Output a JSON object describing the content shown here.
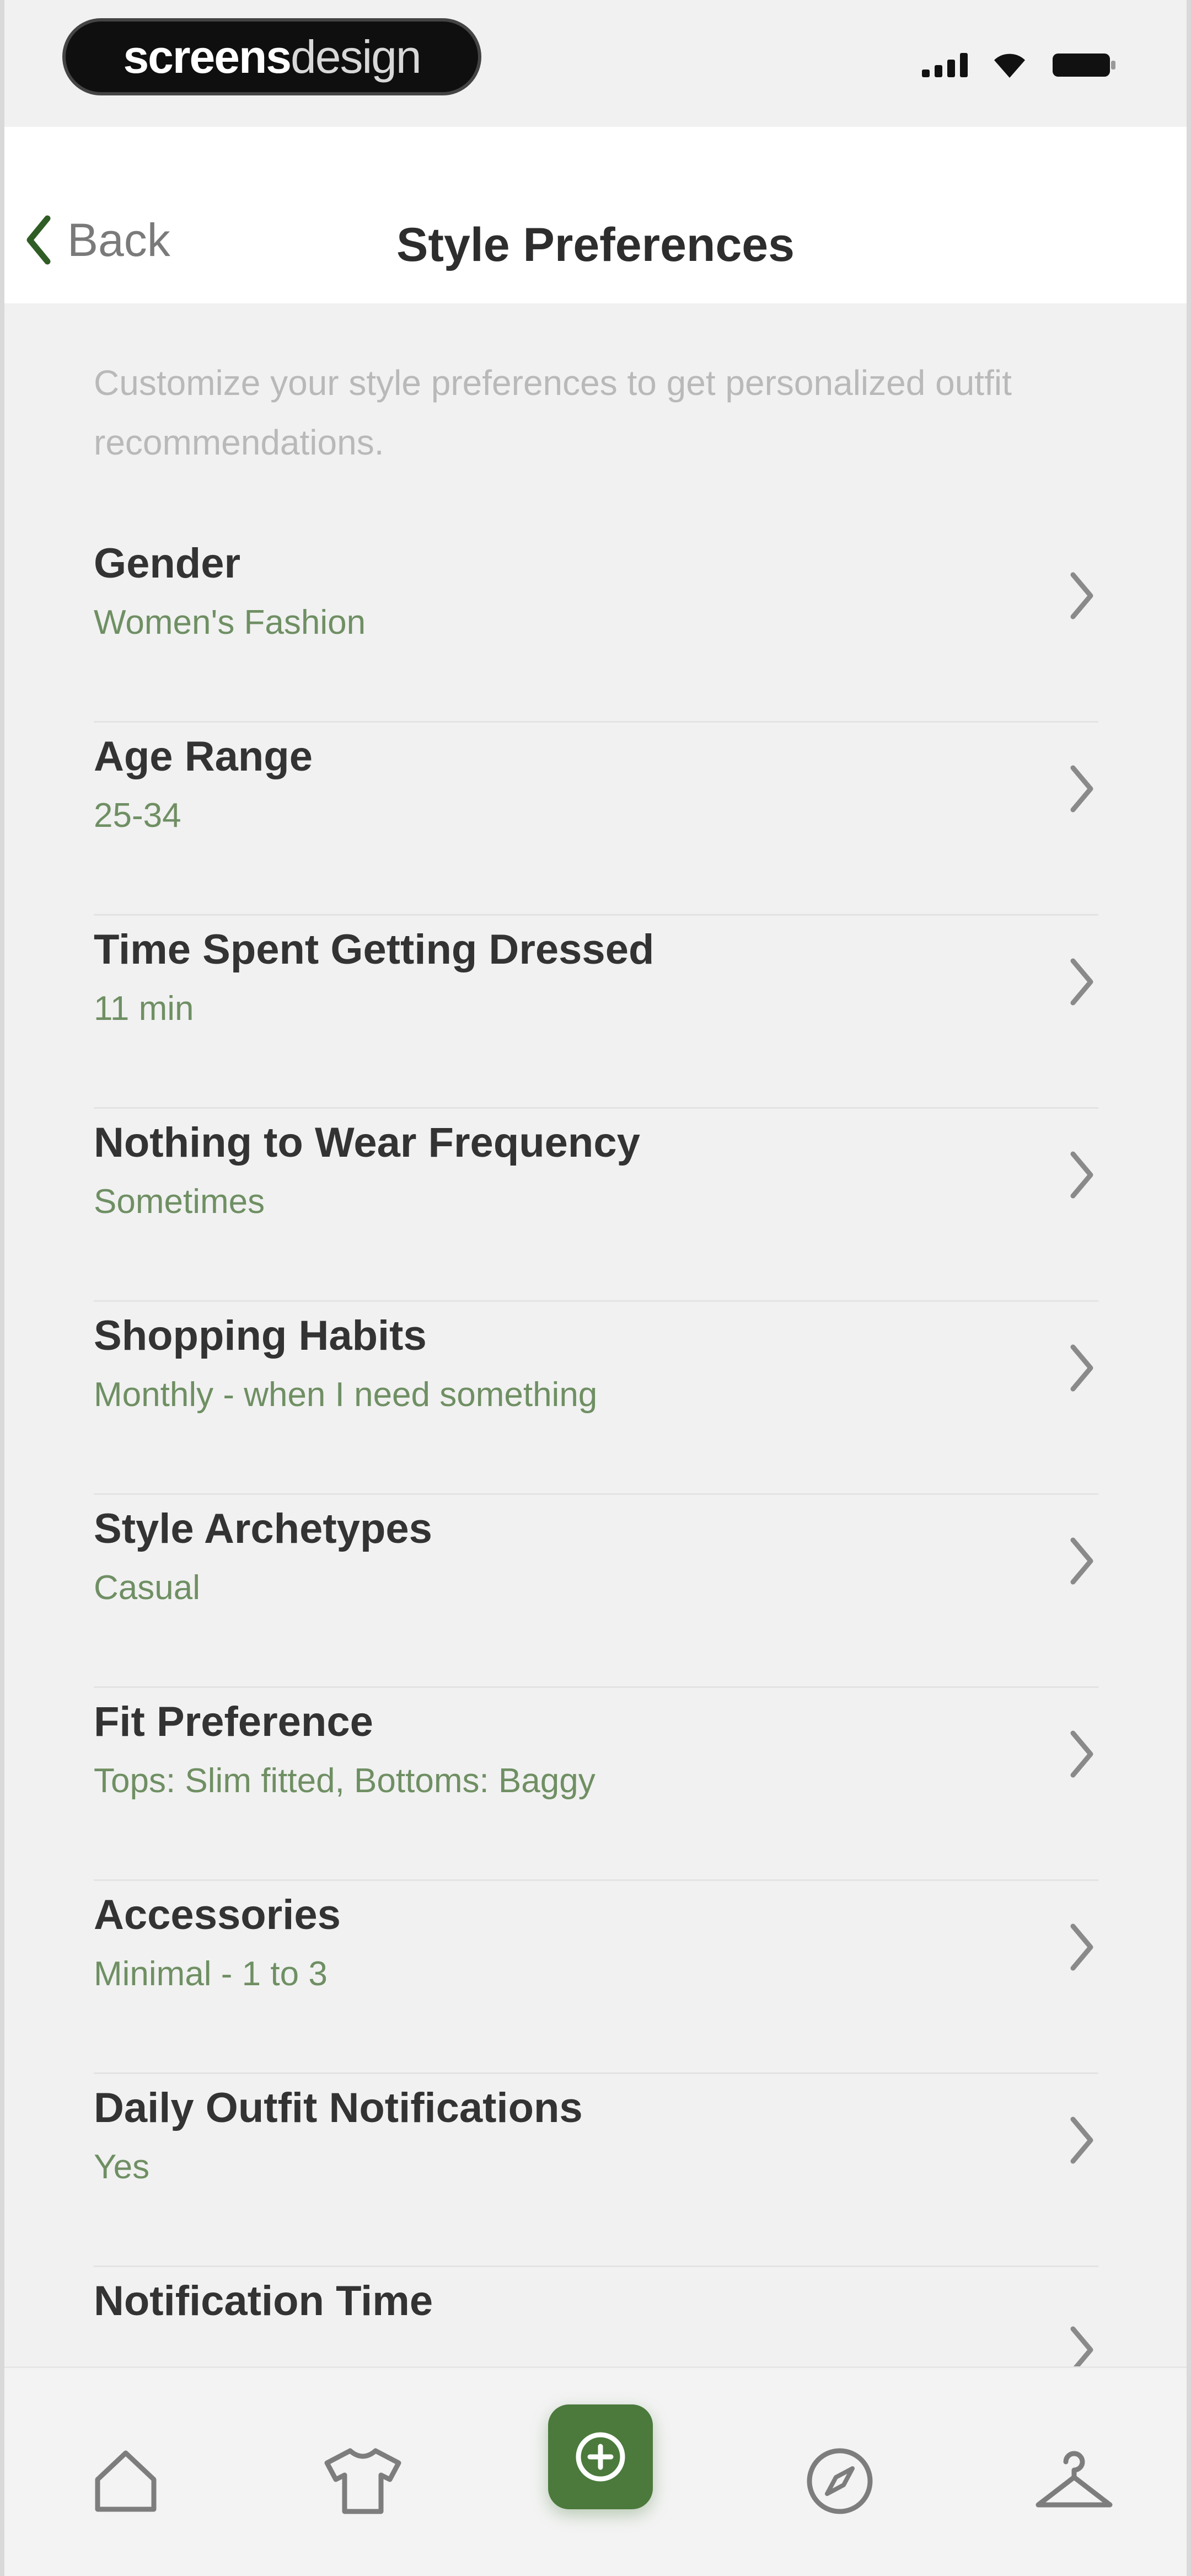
{
  "status_bar": {
    "brand_bold": "screens",
    "brand_light": "design",
    "icons": [
      "signal-icon",
      "wifi-icon",
      "battery-icon"
    ]
  },
  "header": {
    "back_label": "Back",
    "title": "Style Preferences"
  },
  "intro_text": "Customize your style preferences to get personalized outfit recommendations.",
  "preferences": [
    {
      "title": "Gender",
      "value": "Women's Fashion"
    },
    {
      "title": "Age Range",
      "value": "25-34"
    },
    {
      "title": "Time Spent Getting Dressed",
      "value": "11 min"
    },
    {
      "title": "Nothing to Wear Frequency",
      "value": "Sometimes"
    },
    {
      "title": "Shopping Habits",
      "value": "Monthly - when I need something"
    },
    {
      "title": "Style Archetypes",
      "value": "Casual"
    },
    {
      "title": "Fit Preference",
      "value": "Tops: Slim fitted, Bottoms: Baggy"
    },
    {
      "title": "Accessories",
      "value": "Minimal - 1 to 3"
    },
    {
      "title": "Daily Outfit Notifications",
      "value": "Yes"
    },
    {
      "title": "Notification Time",
      "value": ""
    }
  ],
  "tab_bar": {
    "items": [
      "home-icon",
      "wardrobe-icon",
      "create-outfit-icon",
      "explore-icon",
      "hanger-icon"
    ],
    "active": "create-outfit-icon"
  },
  "colors": {
    "accent": "#4b7a3c",
    "value_text": "#6f8f63",
    "background": "#f1f1f1"
  }
}
